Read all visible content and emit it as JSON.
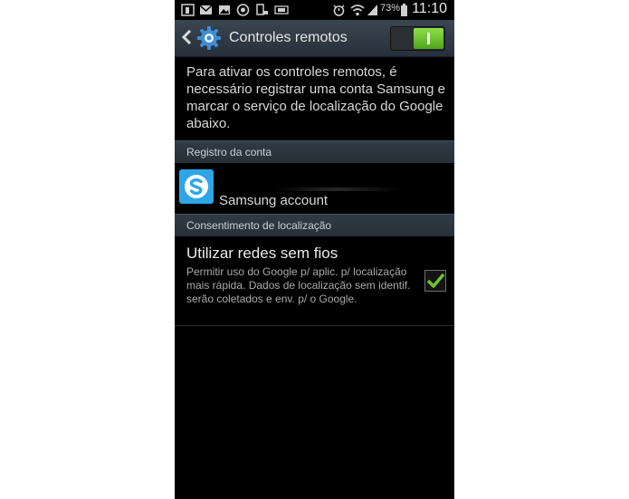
{
  "status_bar": {
    "battery": "73%",
    "time": "11:10",
    "left_icons": [
      "notification-1-icon",
      "gmail-icon",
      "gallery-icon",
      "whatsapp-icon",
      "usb-icon",
      "nfc-icon"
    ],
    "right_icons": [
      "alarm-icon",
      "wifi-icon",
      "signal-icon",
      "battery-icon"
    ]
  },
  "action_bar": {
    "title": "Controles remotos",
    "toggle_on": true,
    "accent": "#5fba27"
  },
  "intro_text": "Para ativar os controles remotos, é necessário registrar uma conta Samsung e marcar o serviço de localização do Google abaixo.",
  "sections": {
    "account": {
      "header": "Registro da conta",
      "item_label": "Samsung account",
      "item_icon": "skype-icon"
    },
    "location": {
      "header": "Consentimento de localização",
      "item_title": "Utilizar redes sem fios",
      "item_desc": "Permitir uso do Google p/ aplic. p/ localização mais rápida. Dados de localização sem identif. serão coletados e env. p/ o Google.",
      "checked": true
    }
  }
}
